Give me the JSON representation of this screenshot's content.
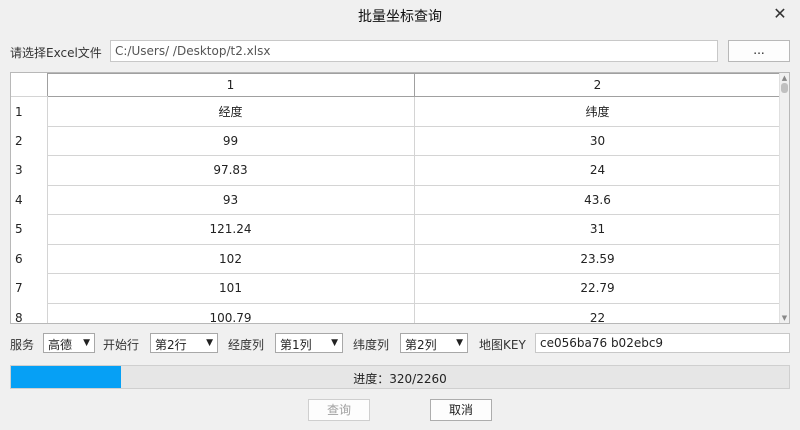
{
  "window": {
    "title": "批量坐标查询"
  },
  "file": {
    "label": "请选择Excel文件",
    "path": "C:/Users/      /Desktop/t2.xlsx",
    "browse_label": "..."
  },
  "table": {
    "columns": [
      "1",
      "2"
    ],
    "rows": [
      {
        "index": "1",
        "cells": [
          "经度",
          "纬度"
        ]
      },
      {
        "index": "2",
        "cells": [
          "99",
          "30"
        ]
      },
      {
        "index": "3",
        "cells": [
          "97.83",
          "24"
        ]
      },
      {
        "index": "4",
        "cells": [
          "93",
          "43.6"
        ]
      },
      {
        "index": "5",
        "cells": [
          "121.24",
          "31"
        ]
      },
      {
        "index": "6",
        "cells": [
          "102",
          "23.59"
        ]
      },
      {
        "index": "7",
        "cells": [
          "101",
          "22.79"
        ]
      },
      {
        "index": "8",
        "cells": [
          "100.79",
          "22"
        ]
      }
    ]
  },
  "options": {
    "service_label": "服务",
    "service_value": "高德",
    "start_row_label": "开始行",
    "start_row_value": "第2行",
    "lng_col_label": "经度列",
    "lng_col_value": "第1列",
    "lat_col_label": "纬度列",
    "lat_col_value": "第2列",
    "key_label": "地图KEY",
    "key_value": "ce056ba76                    b02ebc9"
  },
  "progress": {
    "text": "进度：320/2260",
    "fraction": 0.1416,
    "color": "#06a0f5"
  },
  "buttons": {
    "query_label": "查询",
    "cancel_label": "取消"
  }
}
